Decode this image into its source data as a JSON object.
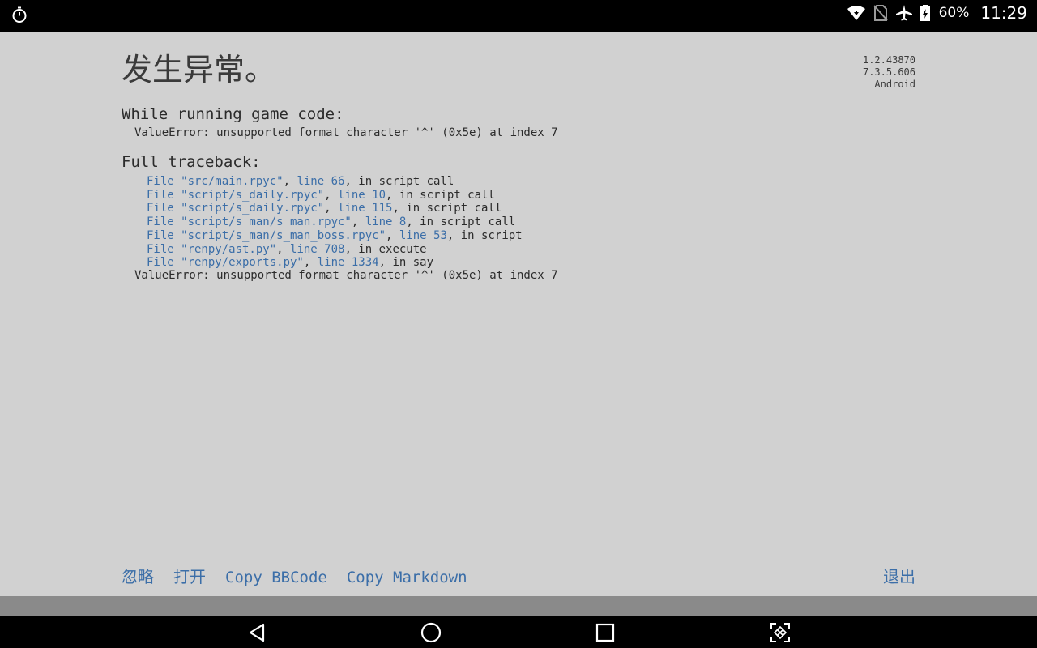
{
  "status_bar": {
    "left_icon": "stopwatch-icon",
    "right_icons": [
      "wifi-icon",
      "no-sim-icon",
      "airplane-icon",
      "battery-charging-icon"
    ],
    "battery": "60%",
    "time": "11:29"
  },
  "error_screen": {
    "title": "发生异常。",
    "versions": [
      "1.2.43870",
      "7.3.5.606",
      "Android"
    ],
    "running_header": "While running game code:",
    "error_message": "ValueError: unsupported format character '^' (0x5e) at index 7",
    "traceback_header": "Full traceback:",
    "traceback": [
      {
        "file": "File \"src/main.rpyc\"",
        "sep": ", ",
        "line": "line 66",
        "rest": ", in script call"
      },
      {
        "file": "File \"script/s_daily.rpyc\"",
        "sep": ", ",
        "line": "line 10",
        "rest": ", in script call"
      },
      {
        "file": "File \"script/s_daily.rpyc\"",
        "sep": ", ",
        "line": "line 115",
        "rest": ", in script call"
      },
      {
        "file": "File \"script/s_man/s_man.rpyc\"",
        "sep": ", ",
        "line": "line 8",
        "rest": ", in script call"
      },
      {
        "file": "File \"script/s_man/s_man_boss.rpyc\"",
        "sep": ", ",
        "line": "line 53",
        "rest": ", in script"
      },
      {
        "file": "File \"renpy/ast.py\"",
        "sep": ", ",
        "line": "line 708",
        "rest": ", in execute"
      },
      {
        "file": "File \"renpy/exports.py\"",
        "sep": ", ",
        "line": "line 1334",
        "rest": ", in say"
      }
    ],
    "final_error": "ValueError: unsupported format character '^' (0x5e) at index 7"
  },
  "buttons": {
    "ignore": "忽略",
    "open": "打开",
    "copy_bbcode": "Copy BBCode",
    "copy_markdown": "Copy Markdown",
    "quit": "退出"
  },
  "nav_bar": {
    "icons": [
      "back-icon",
      "home-icon",
      "recents-icon",
      "screenshot-icon"
    ]
  },
  "colors": {
    "background": "#d1d1d1",
    "link": "#3b6ea8",
    "text": "#2b2b2b"
  }
}
